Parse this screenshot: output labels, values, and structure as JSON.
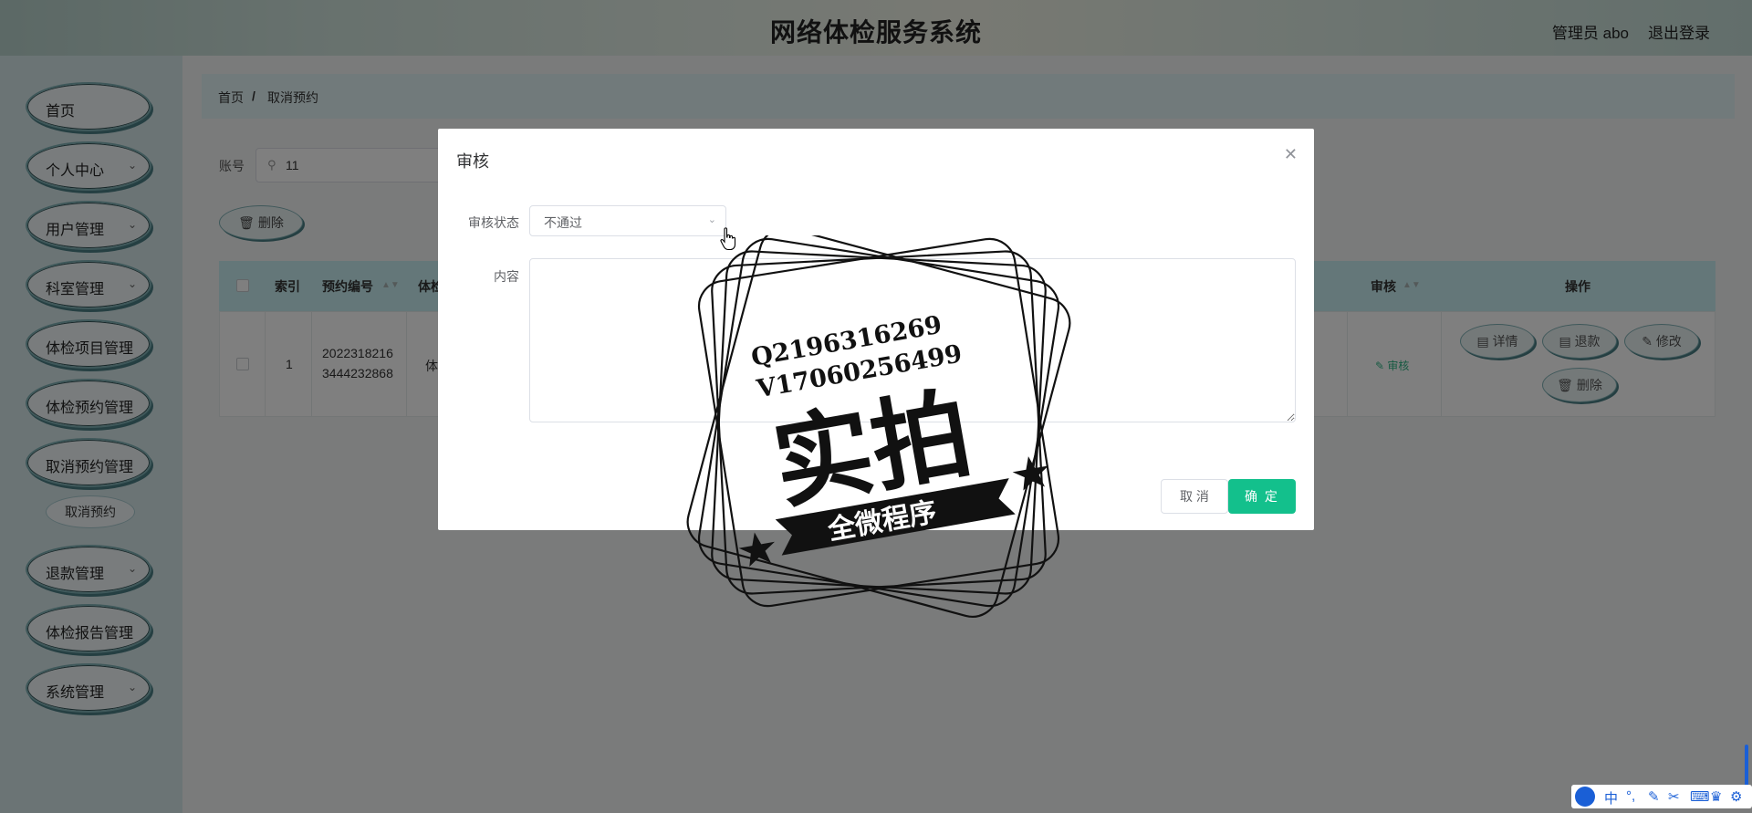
{
  "header": {
    "title": "网络体检服务系统",
    "user": "管理员 abo",
    "logout": "退出登录"
  },
  "sidebar": {
    "items": [
      {
        "label": "首页"
      },
      {
        "label": "个人中心"
      },
      {
        "label": "用户管理"
      },
      {
        "label": "科室管理"
      },
      {
        "label": "体检项目管理"
      },
      {
        "label": "体检预约管理"
      },
      {
        "label": "取消预约管理"
      },
      {
        "label": "退款管理"
      },
      {
        "label": "体检报告管理"
      },
      {
        "label": "系统管理"
      }
    ],
    "sub_item": "取消预约"
  },
  "breadcrumb": {
    "home": "首页",
    "sep": "/",
    "current": "取消预约"
  },
  "search": {
    "label": "账号",
    "value": "11"
  },
  "toolbar": {
    "delete_label": "删除"
  },
  "table": {
    "headers": {
      "index": "索引",
      "order_no": "预约编号",
      "exam": "体检",
      "audit": "审核",
      "actions": "操作"
    },
    "row": {
      "index": "1",
      "order_no_1": "2022318216",
      "order_no_2": "3444232868",
      "exam": "体",
      "audit_link": "审核"
    },
    "row_actions": {
      "detail": "详情",
      "refund": "退款",
      "edit": "修改",
      "delete": "删除"
    }
  },
  "dialog": {
    "title": "审核",
    "status_label": "审核状态",
    "status_value": "不通过",
    "content_label": "内容",
    "cancel_label": "取 消",
    "ok_label": "确 定"
  },
  "watermark": {
    "line1": "Q2196316269",
    "line2": "V17060256499",
    "big": "实拍",
    "ribbon": "全微程序"
  },
  "ime": {
    "mode": "中"
  },
  "colors": {
    "primary": "#13c08c",
    "sidebar_bg": "#d7e9eb",
    "table_head": "#c8eef2",
    "audit_link": "#2fb585"
  }
}
